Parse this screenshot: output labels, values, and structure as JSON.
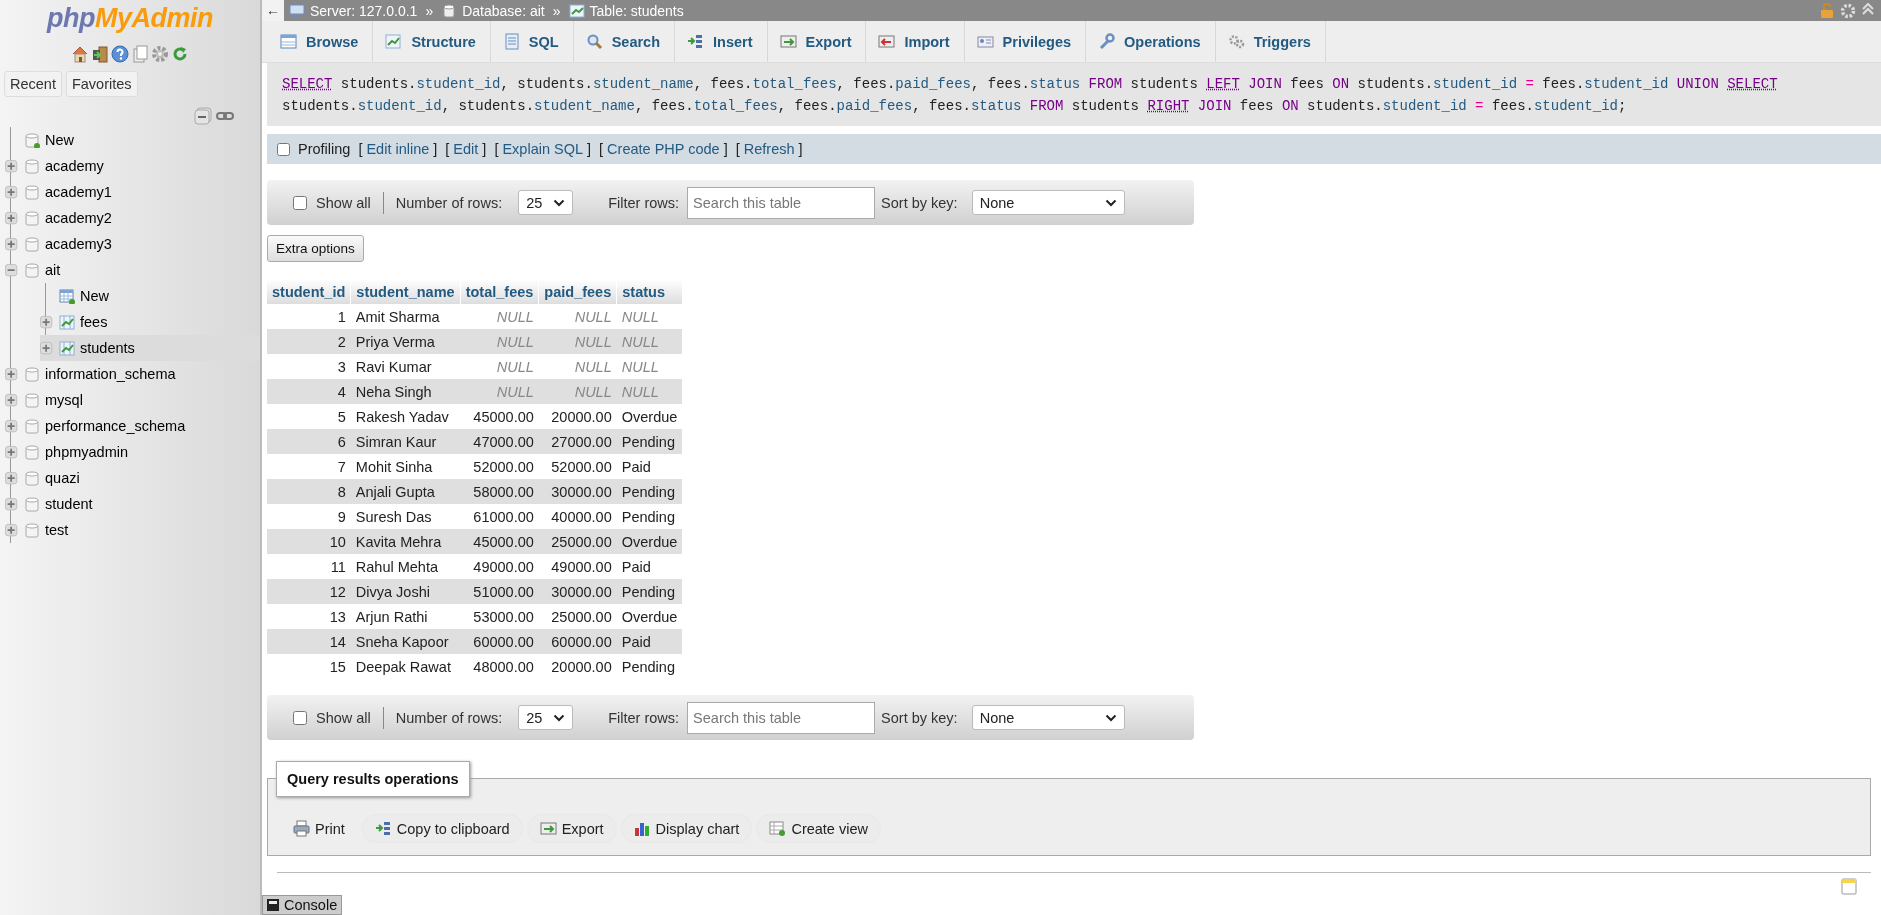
{
  "sidebar": {
    "logo": {
      "part_1": "php",
      "part_2": "MyAdmin"
    },
    "tabs": [
      {
        "label": "Recent"
      },
      {
        "label": "Favorites"
      }
    ],
    "tree": [
      {
        "kind": "new",
        "label": "New",
        "selected": false
      },
      {
        "kind": "database",
        "label": "academy",
        "expanded": false,
        "selected": false
      },
      {
        "kind": "database",
        "label": "academy1",
        "expanded": false,
        "selected": false
      },
      {
        "kind": "database",
        "label": "academy2",
        "expanded": false,
        "selected": false
      },
      {
        "kind": "database",
        "label": "academy3",
        "expanded": false,
        "selected": false
      },
      {
        "kind": "database",
        "label": "ait",
        "expanded": true,
        "selected": false,
        "children": [
          {
            "kind": "new_table",
            "label": "New",
            "selected": false
          },
          {
            "kind": "table",
            "label": "fees",
            "expanded": false,
            "selected": false
          },
          {
            "kind": "table",
            "label": "students",
            "expanded": false,
            "selected": true
          }
        ]
      },
      {
        "kind": "database",
        "label": "information_schema",
        "expanded": false,
        "selected": false
      },
      {
        "kind": "database",
        "label": "mysql",
        "expanded": false,
        "selected": false
      },
      {
        "kind": "database",
        "label": "performance_schema",
        "expanded": false,
        "selected": false
      },
      {
        "kind": "database",
        "label": "phpmyadmin",
        "expanded": false,
        "selected": false
      },
      {
        "kind": "database",
        "label": "quazi",
        "expanded": false,
        "selected": false
      },
      {
        "kind": "database",
        "label": "student",
        "expanded": false,
        "selected": false
      },
      {
        "kind": "database",
        "label": "test",
        "expanded": false,
        "selected": false
      }
    ]
  },
  "breadcrumb": {
    "back": "←",
    "items": [
      {
        "kind": "server",
        "label": "Server: 127.0.0.1"
      },
      {
        "kind": "database",
        "label": "Database: ait"
      },
      {
        "kind": "table",
        "label": "Table: students"
      }
    ],
    "separators": [
      "»",
      "»"
    ]
  },
  "tabs": [
    {
      "kind": "browse",
      "label": "Browse",
      "selected": false
    },
    {
      "kind": "structure",
      "label": "Structure",
      "selected": false
    },
    {
      "kind": "sql",
      "label": "SQL",
      "selected": false
    },
    {
      "kind": "search",
      "label": "Search",
      "selected": false
    },
    {
      "kind": "insert",
      "label": "Insert",
      "selected": false
    },
    {
      "kind": "export",
      "label": "Export",
      "selected": false
    },
    {
      "kind": "import",
      "label": "Import",
      "selected": false
    },
    {
      "kind": "privileges",
      "label": "Privileges",
      "selected": false
    },
    {
      "kind": "operations",
      "label": "Operations",
      "selected": false
    },
    {
      "kind": "triggers",
      "label": "Triggers",
      "selected": false
    }
  ],
  "sql": [
    {
      "kind": "func",
      "text": "SELECT"
    },
    {
      "kind": "text",
      "text": " students."
    },
    {
      "kind": "field",
      "text": "student_id"
    },
    {
      "kind": "text",
      "text": ", students."
    },
    {
      "kind": "field",
      "text": "student_name"
    },
    {
      "kind": "text",
      "text": ", fees."
    },
    {
      "kind": "field",
      "text": "total_fees"
    },
    {
      "kind": "text",
      "text": ", fees."
    },
    {
      "kind": "field",
      "text": "paid_fees"
    },
    {
      "kind": "text",
      "text": ", fees."
    },
    {
      "kind": "field",
      "text": "status"
    },
    {
      "kind": "kw",
      "text": " FROM"
    },
    {
      "kind": "text",
      "text": " students "
    },
    {
      "kind": "func",
      "text": "LEFT"
    },
    {
      "kind": "kw",
      "text": " JOIN"
    },
    {
      "kind": "text",
      "text": " fees "
    },
    {
      "kind": "kw",
      "text": "ON"
    },
    {
      "kind": "text",
      "text": " students."
    },
    {
      "kind": "field",
      "text": "student_id"
    },
    {
      "kind": "op",
      "text": " ="
    },
    {
      "kind": "text",
      "text": " fees."
    },
    {
      "kind": "field",
      "text": "student_id"
    },
    {
      "kind": "kw",
      "text": " UNION "
    },
    {
      "kind": "func",
      "text": "SELECT"
    },
    {
      "kind": "text",
      "text": " students."
    },
    {
      "kind": "field",
      "text": "student_id"
    },
    {
      "kind": "text",
      "text": ", students."
    },
    {
      "kind": "field",
      "text": "student_name"
    },
    {
      "kind": "text",
      "text": ", fees."
    },
    {
      "kind": "field",
      "text": "total_fees"
    },
    {
      "kind": "text",
      "text": ", fees."
    },
    {
      "kind": "field",
      "text": "paid_fees"
    },
    {
      "kind": "text",
      "text": ", fees."
    },
    {
      "kind": "field",
      "text": "status"
    },
    {
      "kind": "kw",
      "text": " FROM"
    },
    {
      "kind": "text",
      "text": " students "
    },
    {
      "kind": "func",
      "text": "RIGHT"
    },
    {
      "kind": "kw",
      "text": " JOIN"
    },
    {
      "kind": "text",
      "text": " fees "
    },
    {
      "kind": "kw",
      "text": "ON"
    },
    {
      "kind": "text",
      "text": " students."
    },
    {
      "kind": "field",
      "text": "student_id"
    },
    {
      "kind": "op",
      "text": " ="
    },
    {
      "kind": "text",
      "text": " fees."
    },
    {
      "kind": "field",
      "text": "student_id"
    },
    {
      "kind": "text",
      "text": ";"
    }
  ],
  "profiling": {
    "label": "Profiling",
    "checked": false,
    "links": [
      {
        "open": "[",
        "label": "Edit inline",
        "close": "]"
      },
      {
        "open": "[",
        "label": "Edit",
        "close": "]"
      },
      {
        "open": "[",
        "label": "Explain SQL",
        "close": "]"
      },
      {
        "open": "[",
        "label": "Create PHP code",
        "close": "]"
      },
      {
        "open": "[",
        "label": "Refresh",
        "close": "]"
      }
    ]
  },
  "filter_bars": [
    {
      "show_all": "Show all",
      "show_all_checked": false,
      "rows_label": "Number of rows:",
      "rows_value": "25",
      "filter_label": "Filter rows:",
      "placeholder": "Search this table",
      "sort_label": "Sort by key:",
      "sort_value": "None"
    },
    {
      "show_all": "Show all",
      "show_all_checked": false,
      "rows_label": "Number of rows:",
      "rows_value": "25",
      "filter_label": "Filter rows:",
      "placeholder": "Search this table",
      "sort_label": "Sort by key:",
      "sort_value": "None"
    }
  ],
  "extra_options": "Extra options",
  "table": {
    "columns": [
      {
        "label": "student_id",
        "numeric": true
      },
      {
        "label": "student_name",
        "numeric": false
      },
      {
        "label": "total_fees",
        "numeric": true
      },
      {
        "label": "paid_fees",
        "numeric": true
      },
      {
        "label": "status",
        "numeric": false
      }
    ],
    "rows": [
      {
        "cells": [
          "1",
          "Amit Sharma",
          "NULL",
          "NULL",
          "NULL"
        ],
        "unmatched": true
      },
      {
        "cells": [
          "2",
          "Priya Verma",
          "NULL",
          "NULL",
          "NULL"
        ],
        "unmatched": true
      },
      {
        "cells": [
          "3",
          "Ravi Kumar",
          "NULL",
          "NULL",
          "NULL"
        ],
        "unmatched": true
      },
      {
        "cells": [
          "4",
          "Neha Singh",
          "NULL",
          "NULL",
          "NULL"
        ],
        "unmatched": true
      },
      {
        "cells": [
          "5",
          "Rakesh Yadav",
          "45000.00",
          "20000.00",
          "Overdue"
        ],
        "unmatched": false
      },
      {
        "cells": [
          "6",
          "Simran Kaur",
          "47000.00",
          "27000.00",
          "Pending"
        ],
        "unmatched": false
      },
      {
        "cells": [
          "7",
          "Mohit Sinha",
          "52000.00",
          "52000.00",
          "Paid"
        ],
        "unmatched": false
      },
      {
        "cells": [
          "8",
          "Anjali Gupta",
          "58000.00",
          "30000.00",
          "Pending"
        ],
        "unmatched": false
      },
      {
        "cells": [
          "9",
          "Suresh Das",
          "61000.00",
          "40000.00",
          "Pending"
        ],
        "unmatched": false
      },
      {
        "cells": [
          "10",
          "Kavita Mehra",
          "45000.00",
          "25000.00",
          "Overdue"
        ],
        "unmatched": false
      },
      {
        "cells": [
          "11",
          "Rahul Mehta",
          "49000.00",
          "49000.00",
          "Paid"
        ],
        "unmatched": false
      },
      {
        "cells": [
          "12",
          "Divya Joshi",
          "51000.00",
          "30000.00",
          "Pending"
        ],
        "unmatched": false
      },
      {
        "cells": [
          "13",
          "Arjun Rathi",
          "53000.00",
          "25000.00",
          "Overdue"
        ],
        "unmatched": false
      },
      {
        "cells": [
          "14",
          "Sneha Kapoor",
          "60000.00",
          "60000.00",
          "Paid"
        ],
        "unmatched": false
      },
      {
        "cells": [
          "15",
          "Deepak Rawat",
          "48000.00",
          "20000.00",
          "Pending"
        ],
        "unmatched": false
      }
    ]
  },
  "operations": {
    "legend": "Query results operations",
    "buttons": [
      {
        "kind": "print",
        "label": "Print"
      },
      {
        "kind": "copy",
        "label": "Copy to clipboard"
      },
      {
        "kind": "export",
        "label": "Export"
      },
      {
        "kind": "chart",
        "label": "Display chart"
      },
      {
        "kind": "view",
        "label": "Create view"
      }
    ]
  },
  "console": {
    "label": "Console"
  }
}
